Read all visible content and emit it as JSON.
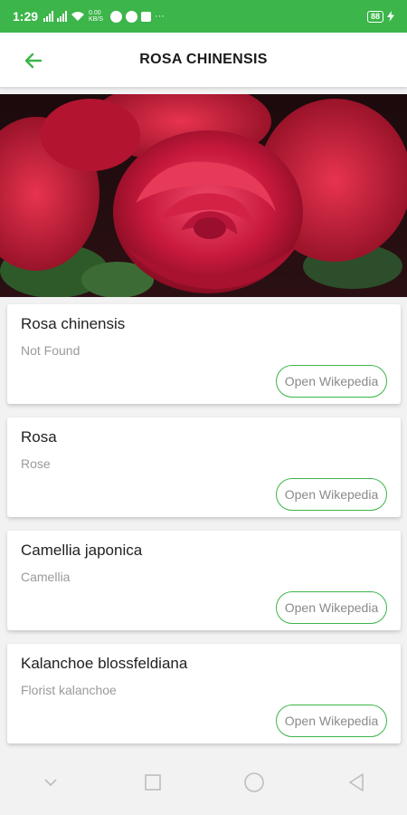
{
  "status_bar": {
    "time": "1:29",
    "data_speed": "0.00 KB/S",
    "battery": "88"
  },
  "app_bar": {
    "title": "ROSA CHINENSIS",
    "back_icon": "arrow-left-icon"
  },
  "results": [
    {
      "name": "Rosa chinensis",
      "common": "Not Found",
      "button": "Open Wikepedia"
    },
    {
      "name": "Rosa",
      "common": "Rose",
      "button": "Open Wikepedia"
    },
    {
      "name": "Camellia japonica",
      "common": "Camellia",
      "button": "Open Wikepedia"
    },
    {
      "name": "Kalanchoe blossfeldiana",
      "common": "Florist kalanchoe",
      "button": "Open Wikepedia"
    }
  ],
  "colors": {
    "accent": "#3cb54a",
    "background": "#f2f2f2",
    "card": "#ffffff"
  },
  "nav_bar": {
    "icons": [
      "chevron-down-icon",
      "square-icon",
      "circle-icon",
      "triangle-back-icon"
    ]
  }
}
